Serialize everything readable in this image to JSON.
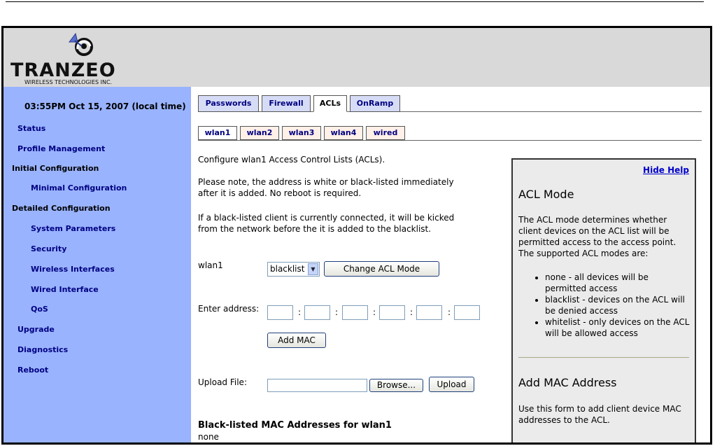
{
  "brand": {
    "name": "TRANZEO",
    "tagline": "WIRELESS TECHNOLOGIES INC."
  },
  "sidebar": {
    "time": "03:55PM Oct 15, 2007 (local time)",
    "items": [
      {
        "label": "Status"
      },
      {
        "label": "Profile Management"
      },
      {
        "label": "Initial Configuration"
      },
      {
        "label": "Minimal Configuration"
      },
      {
        "label": "Detailed Configuration"
      },
      {
        "label": "System Parameters"
      },
      {
        "label": "Security"
      },
      {
        "label": "Wireless Interfaces"
      },
      {
        "label": "Wired Interface"
      },
      {
        "label": "QoS"
      },
      {
        "label": "Upgrade"
      },
      {
        "label": "Diagnostics"
      },
      {
        "label": "Reboot"
      }
    ]
  },
  "tabs": {
    "main": [
      "Passwords",
      "Firewall",
      "ACLs",
      "OnRamp"
    ],
    "active_main": "ACLs",
    "sub": [
      "wlan1",
      "wlan2",
      "wlan3",
      "wlan4",
      "wired"
    ],
    "active_sub": "wlan1"
  },
  "main": {
    "intro": "Configure wlan1 Access Control Lists (ACLs).",
    "note_line1": "Please note, the address is white or black-listed immediately",
    "note_line2": "after it is added. No reboot is required.",
    "kick_line1": "If a black-listed client is currently connected, it will be kicked",
    "kick_line2": "from the network before the it is added to the blacklist.",
    "mode_label": "wlan1",
    "mode_value": "blacklist",
    "change_mode_button": "Change ACL Mode",
    "address_label": "Enter address:",
    "add_mac_button": "Add MAC",
    "upload_label": "Upload File:",
    "browse_button": "Browse...",
    "upload_button": "Upload",
    "list_title": "Black-listed MAC Addresses for wlan1",
    "list_value": "none"
  },
  "help": {
    "hide_link": "Hide Help",
    "acl_title": "ACL Mode",
    "acl_text": "The ACL mode determines whether client devices on the ACL list will be permitted access to the access point. The supported ACL modes are:",
    "bullets": [
      "none - all devices will be permitted access",
      "blacklist - devices on the ACL will be denied access",
      "whitelist - only devices on the ACL will be allowed access"
    ],
    "mac_title": "Add MAC Address",
    "mac_text": "Use this form to add client device MAC addresses to the ACL."
  },
  "colors": {
    "sidebar_bg": "#99b3ff",
    "header_bg": "#d9d9d9",
    "link": "#000080",
    "help_bg": "#ebebeb"
  }
}
